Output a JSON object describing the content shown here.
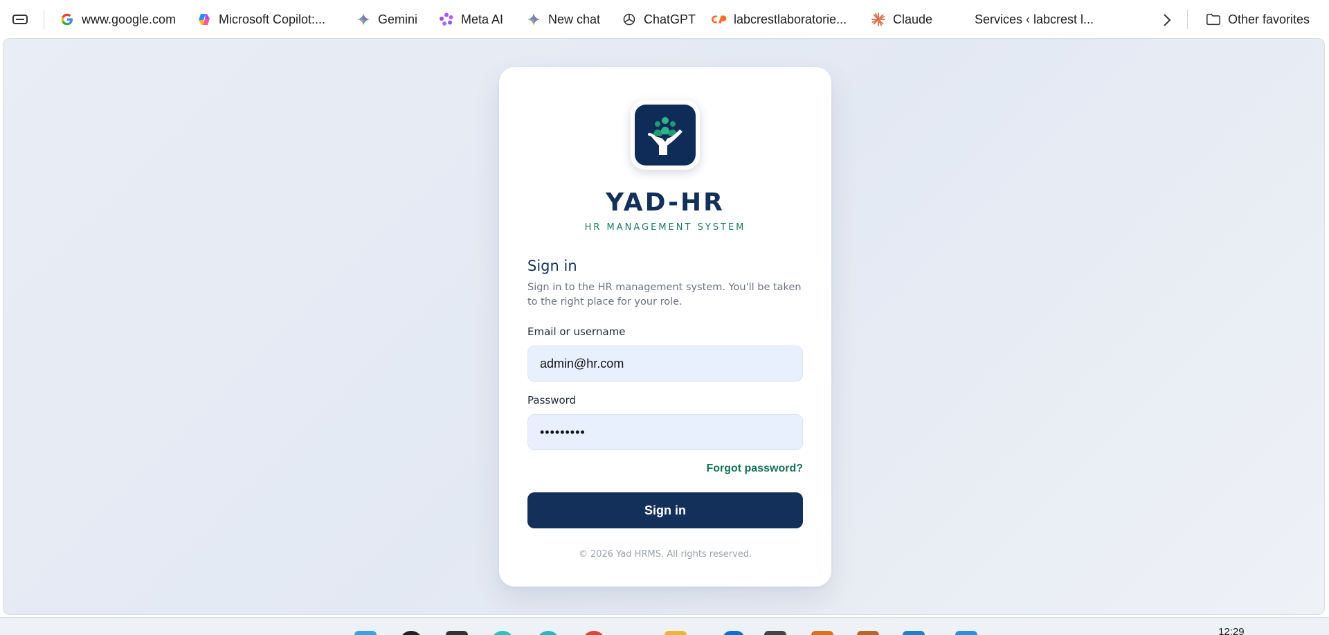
{
  "favorites_bar": {
    "items": [
      {
        "label": "www.google.com",
        "icon": "google-icon"
      },
      {
        "label": "Microsoft Copilot:...",
        "icon": "copilot-icon"
      },
      {
        "label": "Gemini",
        "icon": "gemini-icon"
      },
      {
        "label": "Meta AI",
        "icon": "meta-ai-icon"
      },
      {
        "label": "New chat",
        "icon": "gemini-icon"
      },
      {
        "label": "ChatGPT",
        "icon": "chatgpt-icon"
      },
      {
        "label": "labcrestlaboratorie...",
        "icon": "cpanel-icon"
      },
      {
        "label": "Claude",
        "icon": "claude-icon"
      },
      {
        "label": "Services ‹ labcrest l...",
        "icon": "none"
      }
    ],
    "other_favorites_label": "Other favorites"
  },
  "login": {
    "brand": "YAD-HR",
    "tagline": "HR MANAGEMENT SYSTEM",
    "heading": "Sign in",
    "subtitle": "Sign in to the HR management system. You'll be taken to the right place for your role.",
    "email_label": "Email or username",
    "email_value": "admin@hr.com",
    "password_label": "Password",
    "password_value": "•••••••••",
    "forgot_label": "Forgot password?",
    "submit_label": "Sign in",
    "footer": "© 2026 Yad HRMS. All rights reserved."
  },
  "taskbar": {
    "clock": "12:29"
  },
  "colors": {
    "brand_navy": "#13305a",
    "accent_green": "#167356",
    "field_bg": "#e8f0fe"
  }
}
